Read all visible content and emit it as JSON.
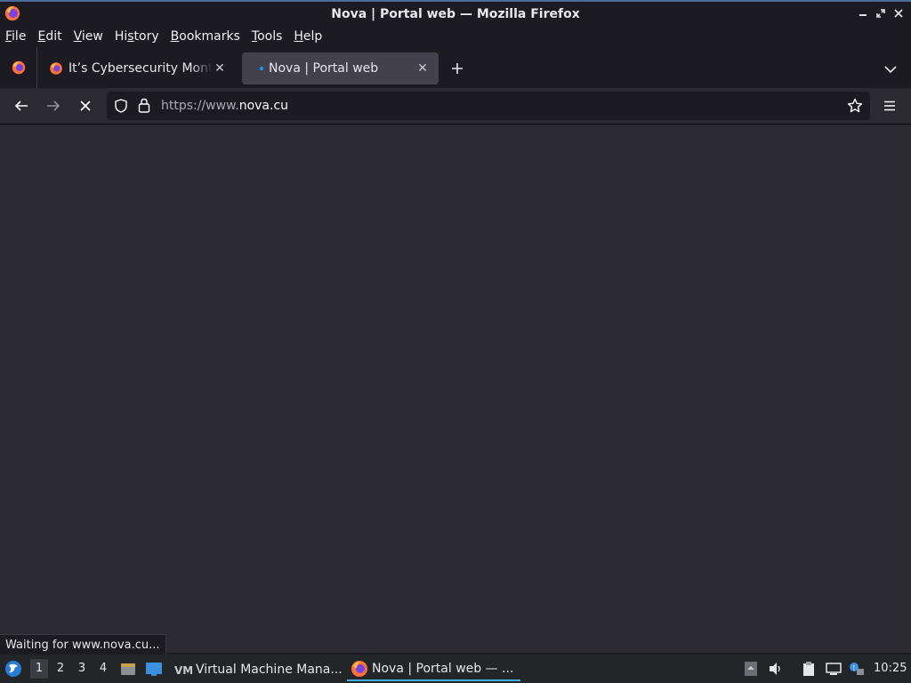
{
  "window": {
    "title": "Nova | Portal web — Mozilla Firefox",
    "controls": [
      "minimize-icon",
      "restore-icon",
      "close-icon"
    ]
  },
  "menu": {
    "file": {
      "u": "F",
      "rest": "ile"
    },
    "edit": {
      "u": "E",
      "rest": "dit"
    },
    "view": {
      "u": "V",
      "rest": "iew"
    },
    "history": {
      "pre": "Hi",
      "u": "s",
      "rest": "tory"
    },
    "bookmarks": {
      "u": "B",
      "rest": "ookmarks"
    },
    "tools": {
      "u": "T",
      "rest": "ools"
    },
    "help": {
      "u": "H",
      "rest": "elp"
    }
  },
  "tabs": [
    {
      "label": "It’s Cybersecurity Month",
      "active": false
    },
    {
      "label": "Nova | Portal web",
      "active": true
    }
  ],
  "navbar": {
    "url_prefix": "https://www.",
    "url_host": "nova.cu"
  },
  "status": {
    "text": "Waiting for www.nova.cu..."
  },
  "taskbar": {
    "workspaces": [
      "1",
      "2",
      "3",
      "4"
    ],
    "active_workspace": "1",
    "tasks": [
      {
        "label": "Virtual Machine Mana..."
      },
      {
        "label": "Nova | Portal web — ..."
      }
    ],
    "clock": "10:25"
  },
  "colors": {
    "toolbar": "#2b2a33",
    "frame": "#1c1b22",
    "accent": "#3daee9"
  }
}
